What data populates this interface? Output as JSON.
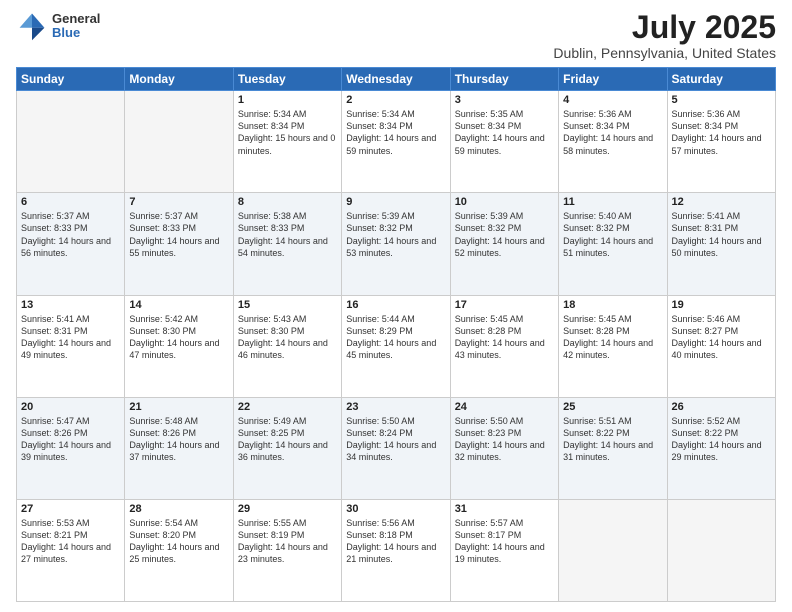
{
  "header": {
    "logo_line1": "General",
    "logo_line2": "Blue",
    "title": "July 2025",
    "subtitle": "Dublin, Pennsylvania, United States"
  },
  "days_of_week": [
    "Sunday",
    "Monday",
    "Tuesday",
    "Wednesday",
    "Thursday",
    "Friday",
    "Saturday"
  ],
  "weeks": [
    [
      {
        "day": "",
        "empty": true
      },
      {
        "day": "",
        "empty": true
      },
      {
        "day": "1",
        "sunrise": "5:34 AM",
        "sunset": "8:34 PM",
        "daylight": "15 hours and 0 minutes."
      },
      {
        "day": "2",
        "sunrise": "5:34 AM",
        "sunset": "8:34 PM",
        "daylight": "14 hours and 59 minutes."
      },
      {
        "day": "3",
        "sunrise": "5:35 AM",
        "sunset": "8:34 PM",
        "daylight": "14 hours and 59 minutes."
      },
      {
        "day": "4",
        "sunrise": "5:36 AM",
        "sunset": "8:34 PM",
        "daylight": "14 hours and 58 minutes."
      },
      {
        "day": "5",
        "sunrise": "5:36 AM",
        "sunset": "8:34 PM",
        "daylight": "14 hours and 57 minutes."
      }
    ],
    [
      {
        "day": "6",
        "sunrise": "5:37 AM",
        "sunset": "8:33 PM",
        "daylight": "14 hours and 56 minutes."
      },
      {
        "day": "7",
        "sunrise": "5:37 AM",
        "sunset": "8:33 PM",
        "daylight": "14 hours and 55 minutes."
      },
      {
        "day": "8",
        "sunrise": "5:38 AM",
        "sunset": "8:33 PM",
        "daylight": "14 hours and 54 minutes."
      },
      {
        "day": "9",
        "sunrise": "5:39 AM",
        "sunset": "8:32 PM",
        "daylight": "14 hours and 53 minutes."
      },
      {
        "day": "10",
        "sunrise": "5:39 AM",
        "sunset": "8:32 PM",
        "daylight": "14 hours and 52 minutes."
      },
      {
        "day": "11",
        "sunrise": "5:40 AM",
        "sunset": "8:32 PM",
        "daylight": "14 hours and 51 minutes."
      },
      {
        "day": "12",
        "sunrise": "5:41 AM",
        "sunset": "8:31 PM",
        "daylight": "14 hours and 50 minutes."
      }
    ],
    [
      {
        "day": "13",
        "sunrise": "5:41 AM",
        "sunset": "8:31 PM",
        "daylight": "14 hours and 49 minutes."
      },
      {
        "day": "14",
        "sunrise": "5:42 AM",
        "sunset": "8:30 PM",
        "daylight": "14 hours and 47 minutes."
      },
      {
        "day": "15",
        "sunrise": "5:43 AM",
        "sunset": "8:30 PM",
        "daylight": "14 hours and 46 minutes."
      },
      {
        "day": "16",
        "sunrise": "5:44 AM",
        "sunset": "8:29 PM",
        "daylight": "14 hours and 45 minutes."
      },
      {
        "day": "17",
        "sunrise": "5:45 AM",
        "sunset": "8:28 PM",
        "daylight": "14 hours and 43 minutes."
      },
      {
        "day": "18",
        "sunrise": "5:45 AM",
        "sunset": "8:28 PM",
        "daylight": "14 hours and 42 minutes."
      },
      {
        "day": "19",
        "sunrise": "5:46 AM",
        "sunset": "8:27 PM",
        "daylight": "14 hours and 40 minutes."
      }
    ],
    [
      {
        "day": "20",
        "sunrise": "5:47 AM",
        "sunset": "8:26 PM",
        "daylight": "14 hours and 39 minutes."
      },
      {
        "day": "21",
        "sunrise": "5:48 AM",
        "sunset": "8:26 PM",
        "daylight": "14 hours and 37 minutes."
      },
      {
        "day": "22",
        "sunrise": "5:49 AM",
        "sunset": "8:25 PM",
        "daylight": "14 hours and 36 minutes."
      },
      {
        "day": "23",
        "sunrise": "5:50 AM",
        "sunset": "8:24 PM",
        "daylight": "14 hours and 34 minutes."
      },
      {
        "day": "24",
        "sunrise": "5:50 AM",
        "sunset": "8:23 PM",
        "daylight": "14 hours and 32 minutes."
      },
      {
        "day": "25",
        "sunrise": "5:51 AM",
        "sunset": "8:22 PM",
        "daylight": "14 hours and 31 minutes."
      },
      {
        "day": "26",
        "sunrise": "5:52 AM",
        "sunset": "8:22 PM",
        "daylight": "14 hours and 29 minutes."
      }
    ],
    [
      {
        "day": "27",
        "sunrise": "5:53 AM",
        "sunset": "8:21 PM",
        "daylight": "14 hours and 27 minutes."
      },
      {
        "day": "28",
        "sunrise": "5:54 AM",
        "sunset": "8:20 PM",
        "daylight": "14 hours and 25 minutes."
      },
      {
        "day": "29",
        "sunrise": "5:55 AM",
        "sunset": "8:19 PM",
        "daylight": "14 hours and 23 minutes."
      },
      {
        "day": "30",
        "sunrise": "5:56 AM",
        "sunset": "8:18 PM",
        "daylight": "14 hours and 21 minutes."
      },
      {
        "day": "31",
        "sunrise": "5:57 AM",
        "sunset": "8:17 PM",
        "daylight": "14 hours and 19 minutes."
      },
      {
        "day": "",
        "empty": true
      },
      {
        "day": "",
        "empty": true
      }
    ]
  ],
  "labels": {
    "sunrise": "Sunrise:",
    "sunset": "Sunset:",
    "daylight": "Daylight:"
  }
}
